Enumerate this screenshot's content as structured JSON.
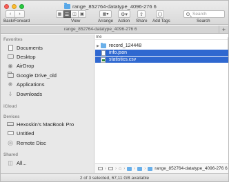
{
  "window": {
    "title": "range_852764-datatype_4096-276 6",
    "tab_title": "range_852764-datatype_4096-276 6",
    "tab_add": "+"
  },
  "toolbar": {
    "back_forward_label": "Back/Forward",
    "view_label": "View",
    "arrange_label": "Arrange",
    "action_label": "Action",
    "share_label": "Share",
    "add_tags_label": "Add Tags",
    "search_label": "Search",
    "search_placeholder": "Search"
  },
  "sidebar": {
    "favorites_header": "Favorites",
    "favorites": [
      {
        "label": "Documents",
        "icon": "documents-icon"
      },
      {
        "label": "Desktop",
        "icon": "desktop-icon"
      },
      {
        "label": "AirDrop",
        "icon": "airdrop-icon"
      },
      {
        "label": "Google Drive_old",
        "icon": "folder-icon"
      },
      {
        "label": "Applications",
        "icon": "applications-icon"
      },
      {
        "label": "Downloads",
        "icon": "downloads-icon"
      }
    ],
    "icloud_header": "iCloud",
    "devices_header": "Devices",
    "devices": [
      {
        "label": "Hexoskin's MacBook Pro",
        "icon": "laptop-icon"
      },
      {
        "label": "Untitled",
        "icon": "disk-icon"
      },
      {
        "label": "Remote Disc",
        "icon": "disc-icon"
      }
    ],
    "shared_header": "Shared",
    "shared": [
      {
        "label": "All...",
        "icon": "network-icon"
      }
    ]
  },
  "content": {
    "column_header": "me",
    "files": [
      {
        "name": "record_124448",
        "type": "folder",
        "selected": false
      },
      {
        "name": "info.json",
        "type": "file",
        "selected": true
      },
      {
        "name": "statistics.csv",
        "type": "csv",
        "selected": true
      }
    ]
  },
  "pathbar": {
    "current": "range_852764-datatype_4096-276 6"
  },
  "status": {
    "text": "2 of 3 selected, 67,11 GB available"
  },
  "colors": {
    "selection": "#2f68d0",
    "folder": "#69afe9"
  }
}
